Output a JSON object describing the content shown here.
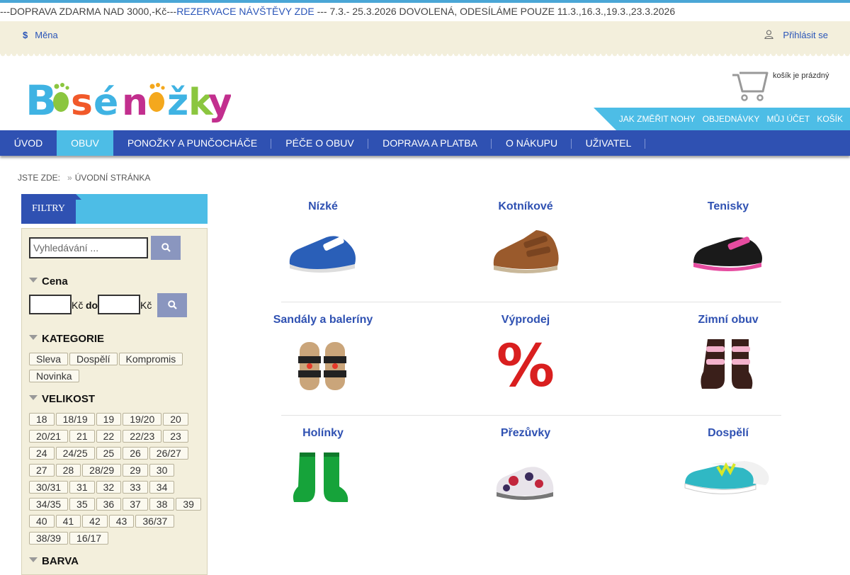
{
  "announcement": {
    "prefix": "---DOPRAVA ZDARMA NAD 3000,-Kč---",
    "link": "REZERVACE NÁVŠTĚVY ZDE",
    "suffix": " --- 7.3.- 25.3.2026 DOVOLENÁ, ODESÍLÁME POUZE 11.3.,16.3.,19.3.,23.3.2026"
  },
  "utility": {
    "currency_label": "Měna",
    "login_label": "Přihlásit se"
  },
  "cart": {
    "status": "košík je prázdný"
  },
  "account_links": [
    "JAK ZMĚŘIT NOHY",
    "OBJEDNÁVKY",
    "MŮJ ÚČET",
    "KOŠÍK"
  ],
  "nav": {
    "items": [
      "ÚVOD",
      "OBUV",
      "PONOŽKY A PUNČOCHÁČE",
      "PÉČE O OBUV",
      "DOPRAVA A PLATBA",
      "O NÁKUPU",
      "UŽIVATEL"
    ],
    "active": "OBUV"
  },
  "breadcrumb": {
    "label": "JSTE ZDE:",
    "current": "ÚVODNÍ STRÁNKA"
  },
  "filter": {
    "title": "FILTRY",
    "search_placeholder": "Vyhledávání ...",
    "price_title": "Cena",
    "currency": "Kč",
    "to": "do",
    "category_title": "KATEGORIE",
    "categories": [
      "Sleva",
      "Dospělí",
      "Kompromis",
      "Novinka"
    ],
    "size_title": "VELIKOST",
    "sizes": [
      "18",
      "18/19",
      "19",
      "19/20",
      "20",
      "20/21",
      "21",
      "22",
      "22/23",
      "23",
      "24",
      "24/25",
      "25",
      "26",
      "26/27",
      "27",
      "28",
      "28/29",
      "29",
      "30",
      "30/31",
      "31",
      "32",
      "33",
      "34",
      "34/35",
      "35",
      "36",
      "37",
      "38",
      "39",
      "40",
      "41",
      "42",
      "43",
      "36/37",
      "38/39",
      "16/17"
    ],
    "color_title": "BARVA"
  },
  "categories_grid": [
    "Nízké",
    "Kotníkové",
    "Tenisky",
    "Sandály a baleríny",
    "Výprodej",
    "Zimní obuv",
    "Holínky",
    "Přezůvky",
    "Dospělí"
  ],
  "colors": {
    "blue": "#2f51b2",
    "cyan": "#4dbde6",
    "cream": "#f3efdc"
  }
}
